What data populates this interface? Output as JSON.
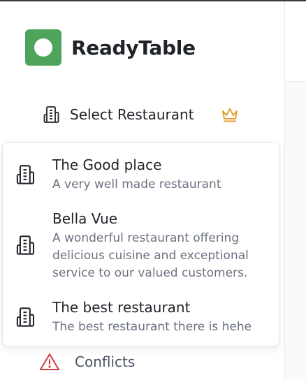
{
  "brand": {
    "name": "ReadyTable",
    "logo_color": "#4ea45b"
  },
  "restaurant_selector": {
    "label": "Select Restaurant",
    "icon": "building-icon",
    "premium_icon": "crown-icon",
    "premium_color": "#e39a2b"
  },
  "dropdown": {
    "options": [
      {
        "name": "The Good place",
        "description": "A very well made restaurant",
        "icon": "building-icon"
      },
      {
        "name": "Bella Vue",
        "description": "A wonderful restaurant offering delicious cuisine and exceptional service to our valued customers.",
        "icon": "building-icon"
      },
      {
        "name": "The best restaurant",
        "description": "The best restaurant there is hehe",
        "icon": "building-icon"
      }
    ]
  },
  "nav": {
    "conflicts": {
      "label": "Conflicts",
      "icon": "warning-triangle-icon",
      "icon_color": "#d33b3b"
    }
  }
}
